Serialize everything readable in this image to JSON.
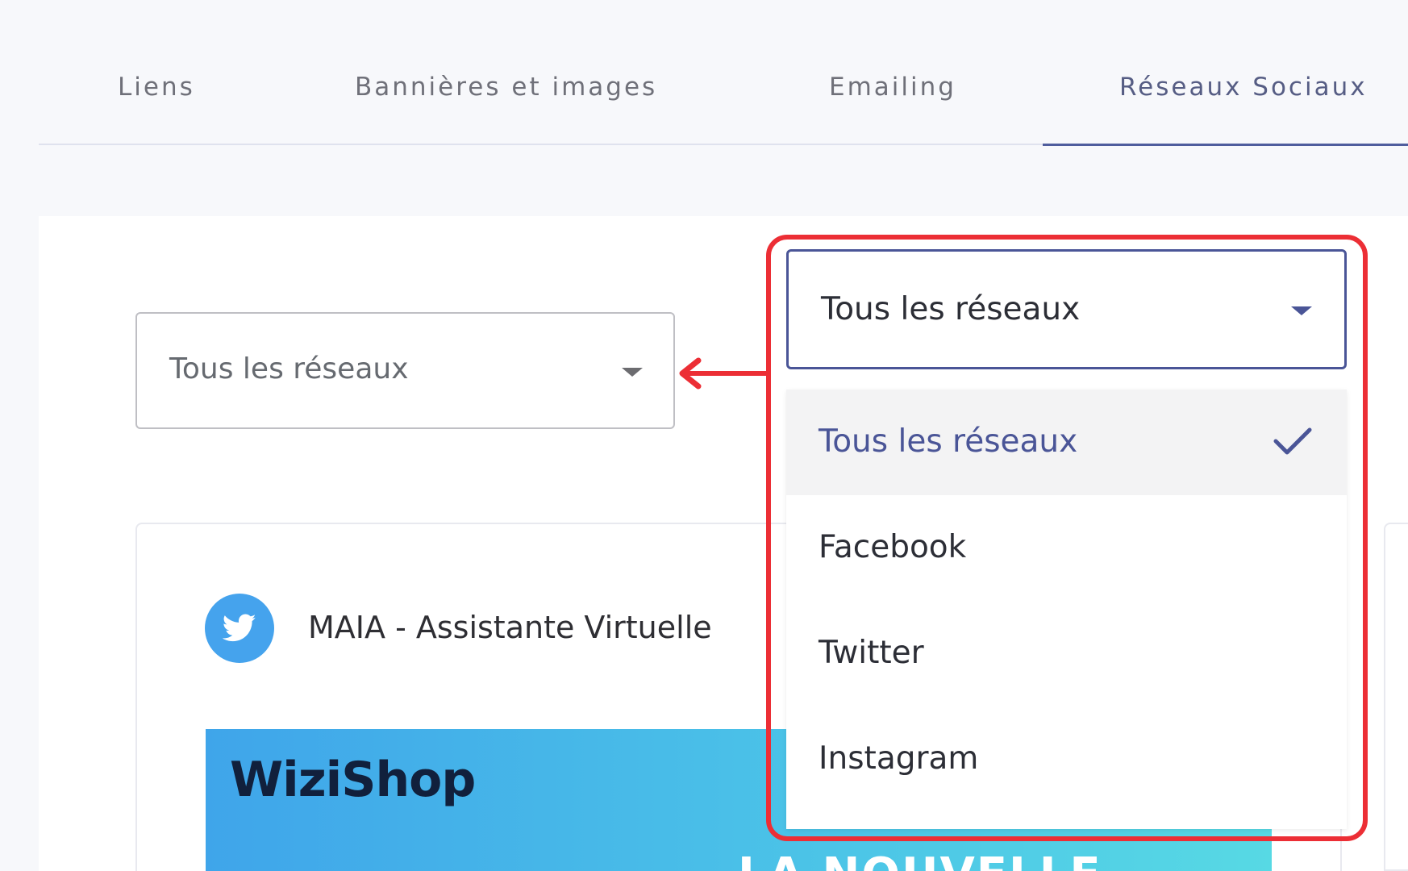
{
  "tabs": [
    {
      "label": "Liens"
    },
    {
      "label": "Bannières et images"
    },
    {
      "label": "Emailing"
    },
    {
      "label": "Réseaux Sociaux",
      "active": true
    }
  ],
  "filter": {
    "selected": "Tous les réseaux"
  },
  "dropdown": {
    "selected": "Tous les réseaux",
    "options": [
      {
        "label": "Tous les réseaux",
        "selected": true
      },
      {
        "label": "Facebook"
      },
      {
        "label": "Twitter"
      },
      {
        "label": "Instagram"
      }
    ]
  },
  "post": {
    "network_icon": "twitter-icon",
    "account_name": "MAIA - Assistante Virtuelle",
    "banner_logo": "WiziShop",
    "banner_text": "LA NOUVELLE"
  },
  "colors": {
    "accent": "#4a5597",
    "annotation": "#ec2e35",
    "twitter": "#45a3ed"
  }
}
